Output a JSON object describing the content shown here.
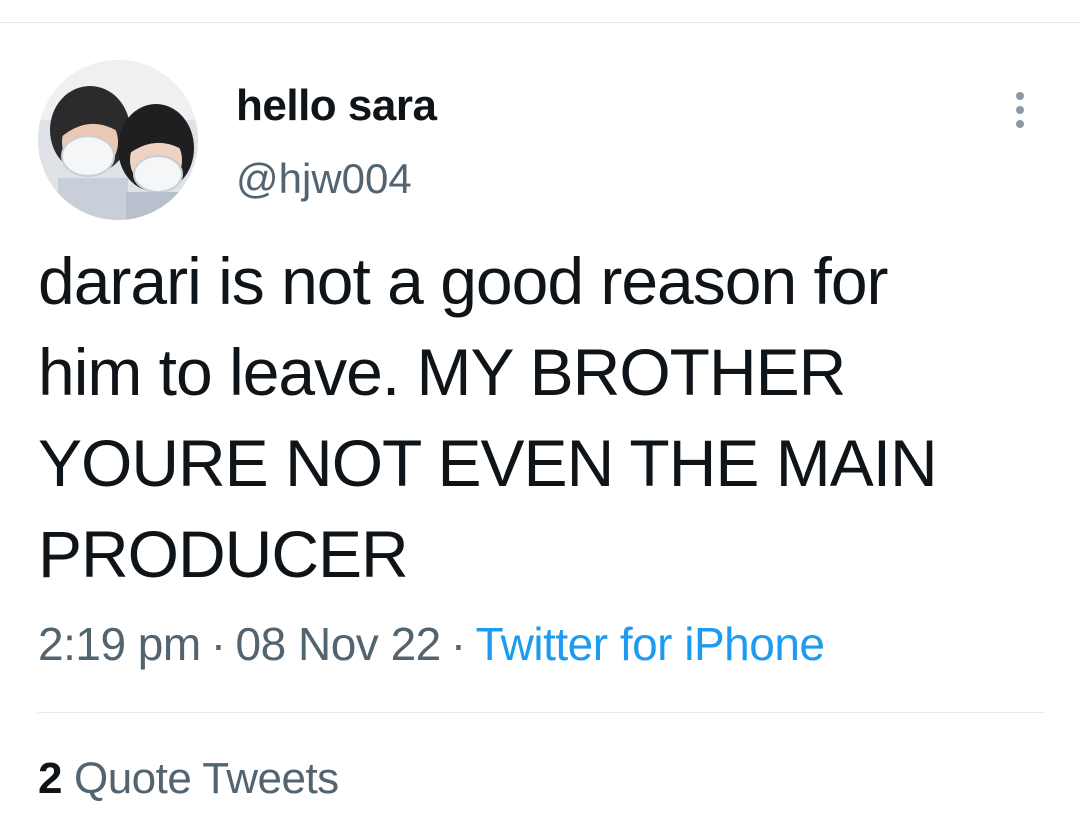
{
  "tweet": {
    "author": {
      "display_name": "hello sara",
      "handle": "@hjw004",
      "avatar_icon": "profile-photo"
    },
    "more_icon": "more-vertical-icon",
    "text_lines": [
      "darari is not a good reason for",
      "him to leave. MY BROTHER",
      "YOURE NOT EVEN THE MAIN",
      "PRODUCER"
    ],
    "meta": {
      "time": "2:19 pm",
      "date": "08 Nov 22",
      "separator": "·",
      "source": "Twitter for iPhone"
    },
    "stats": {
      "quote_count": "2",
      "quote_label": "Quote Tweets"
    }
  },
  "colors": {
    "text_primary": "#0f1419",
    "text_secondary": "#536471",
    "link": "#1d9bf0",
    "divider": "#e6e9ec"
  }
}
